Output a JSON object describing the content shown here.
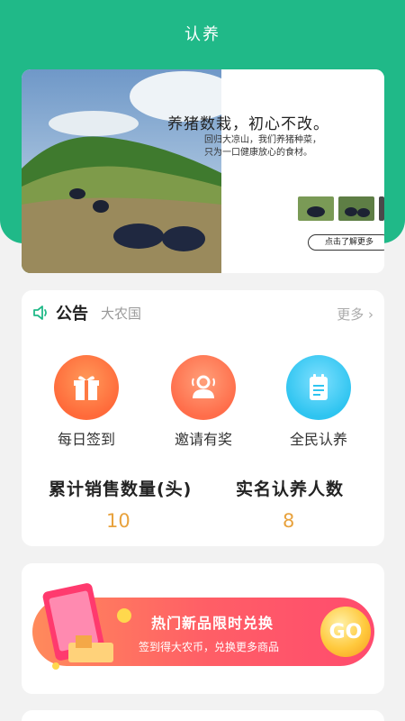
{
  "page": {
    "title": "认养"
  },
  "colors": {
    "brand_green": "#20b988",
    "accent_orange": "#e8a23d"
  },
  "banner": {
    "title": "养猪数栽，初心不改。",
    "subtitle_line1": "回归大凉山，我们养猪种菜，",
    "subtitle_line2": "只为一口健康放心的食材。",
    "button_label": "点击了解更多"
  },
  "notice": {
    "icon": "speaker-icon",
    "label": "公告",
    "text": "大农国",
    "more_label": "更多",
    "more_icon": "chevron-right-icon"
  },
  "functions": [
    {
      "label": "每日签到",
      "icon": "gift-icon",
      "color": "#ff6a3a"
    },
    {
      "label": "邀请有奖",
      "icon": "invite-user-icon",
      "color": "#ff6d4a"
    },
    {
      "label": "全民认养",
      "icon": "notepad-icon",
      "color": "#2ec4f0"
    }
  ],
  "stats": [
    {
      "label": "累计销售数量(头)",
      "value": "10"
    },
    {
      "label": "实名认养人数",
      "value": "8"
    }
  ],
  "promo": {
    "title": "热门新品限时兑换",
    "subtitle": "签到得大农币，兑换更多商品",
    "go_label": "GO"
  }
}
